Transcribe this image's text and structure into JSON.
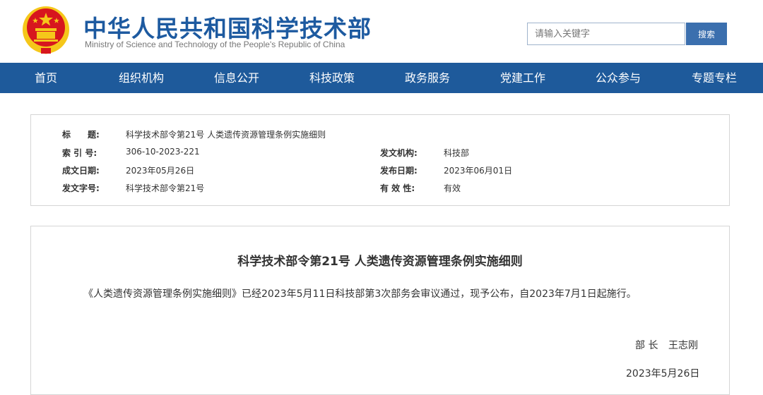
{
  "header": {
    "title": "中华人民共和国科学技术部",
    "subtitle": "Ministry of Science and Technology of the People's Republic of China",
    "search_placeholder": "请输入关键字",
    "search_button": "搜索",
    "colors": {
      "brand": "#1d5aa0",
      "nav": "#1e5a9b",
      "emblem_red": "#d7161e",
      "emblem_gold": "#f5c71a"
    }
  },
  "nav": {
    "items": [
      {
        "label": "首页"
      },
      {
        "label": "组织机构"
      },
      {
        "label": "信息公开"
      },
      {
        "label": "科技政策"
      },
      {
        "label": "政务服务"
      },
      {
        "label": "党建工作"
      },
      {
        "label": "公众参与"
      },
      {
        "label": "专题专栏"
      }
    ]
  },
  "meta": {
    "title_label": "标　　题:",
    "title_value": "科学技术部令第21号 人类遗传资源管理条例实施细则",
    "index_label": "索 引 号:",
    "index_value": "306-10-2023-221",
    "issuer_label": "发文机构:",
    "issuer_value": "科技部",
    "created_label": "成文日期:",
    "created_value": "2023年05月26日",
    "published_label": "发布日期:",
    "published_value": "2023年06月01日",
    "docno_label": "发文字号:",
    "docno_value": "科学技术部令第21号",
    "validity_label": "有 效 性:",
    "validity_value": "有效"
  },
  "document": {
    "title": "科学技术部令第21号 人类遗传资源管理条例实施细则",
    "body": "《人类遗传资源管理条例实施细则》已经2023年5月11日科技部第3次部务会审议通过，现予公布，自2023年7月1日起施行。",
    "sign_role": "部 长",
    "sign_name": "王志刚",
    "sign_date": "2023年5月26日"
  }
}
